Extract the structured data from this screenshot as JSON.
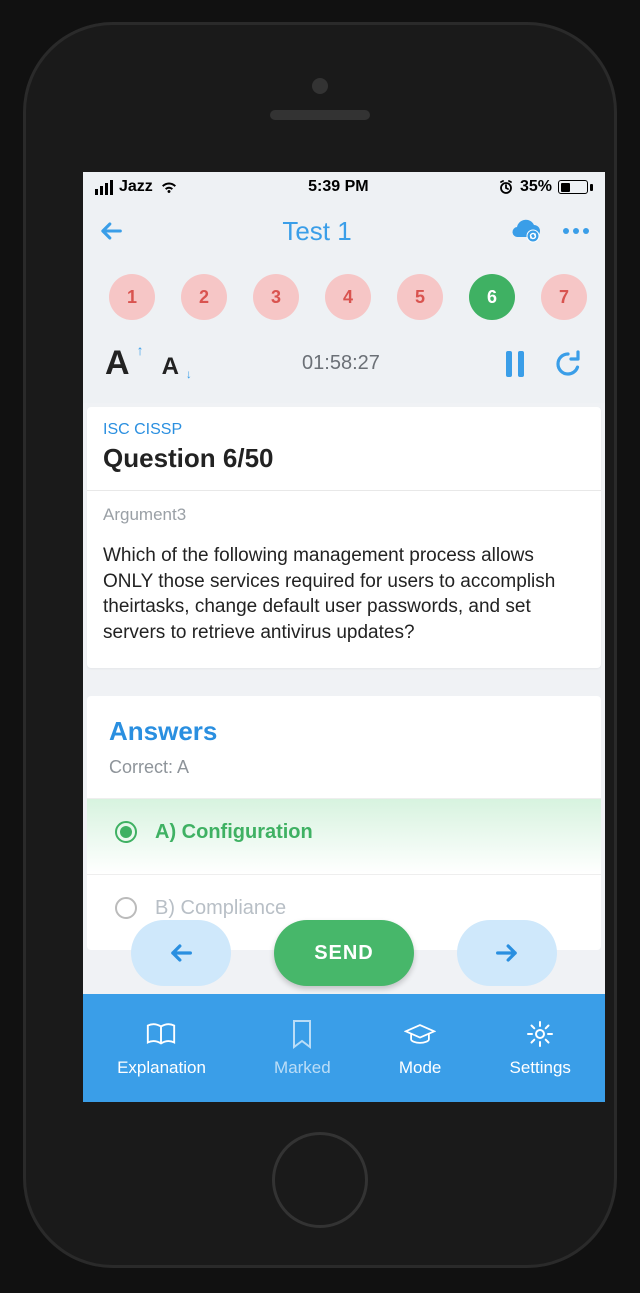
{
  "statusbar": {
    "carrier": "Jazz",
    "time": "5:39 PM",
    "battery_pct": "35%"
  },
  "navbar": {
    "title": "Test 1"
  },
  "question_strip": {
    "items": [
      "1",
      "2",
      "3",
      "4",
      "5",
      "6",
      "7"
    ],
    "active_index": 5
  },
  "controls": {
    "timer": "01:58:27"
  },
  "question": {
    "course": "ISC CISSP",
    "title": "Question 6/50",
    "argument_label": "Argument3",
    "text": "Which of the following management process allows ONLY those services required for users to accomplish theirtasks, change default user passwords, and set servers to retrieve antivirus updates?"
  },
  "answers": {
    "heading": "Answers",
    "correct_label": "Correct: A",
    "options": [
      {
        "label": "A) Configuration",
        "correct": true
      },
      {
        "label": "B) Compliance",
        "correct": false
      }
    ]
  },
  "actions": {
    "send": "SEND"
  },
  "bottombar": {
    "explanation": "Explanation",
    "marked": "Marked",
    "mode": "Mode",
    "settings": "Settings"
  }
}
